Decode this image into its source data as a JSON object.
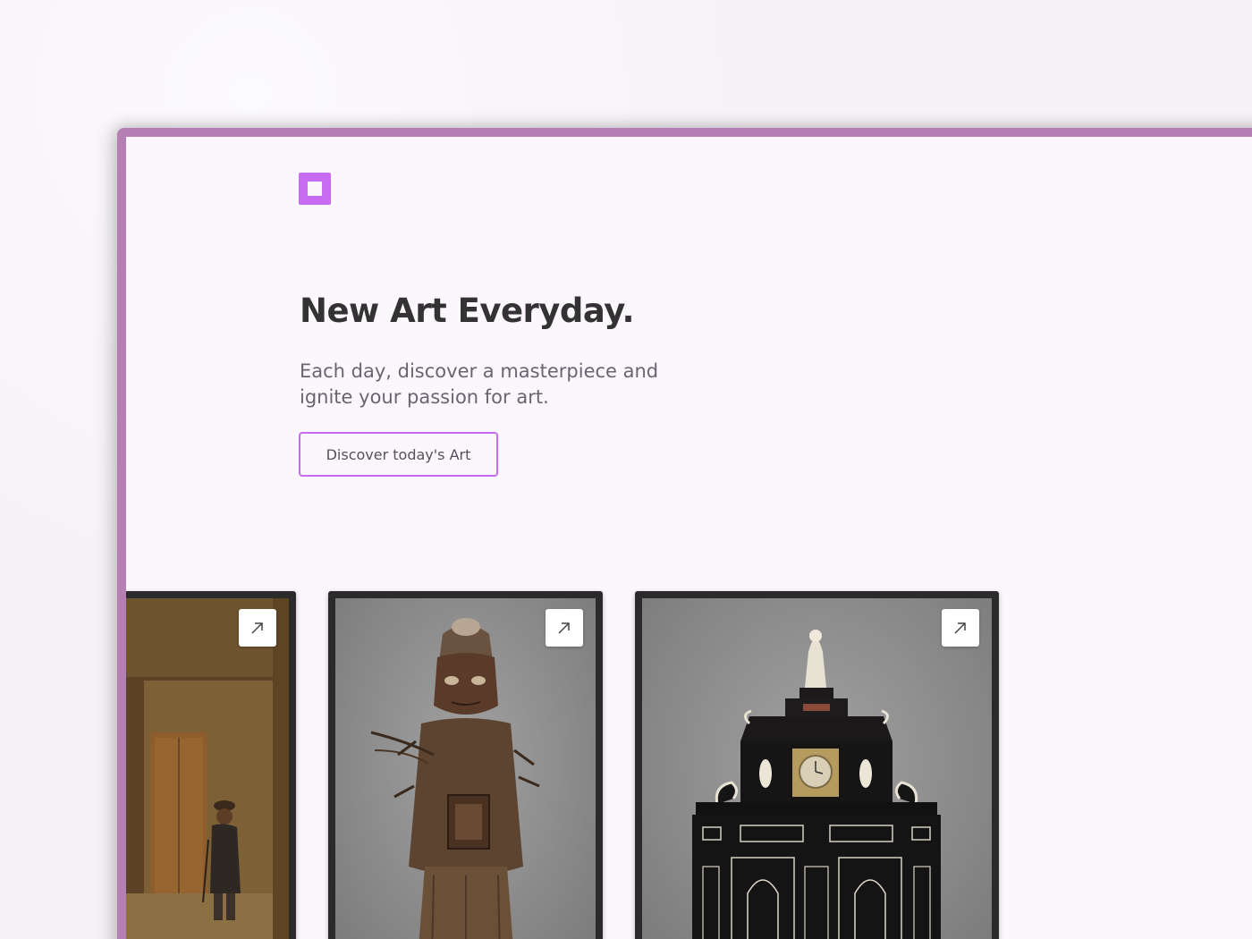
{
  "brand": {
    "logo_icon": "square-logo-icon",
    "accent_color": "#c76bf0",
    "frame_color": "#b67fb4"
  },
  "hero": {
    "title": "New Art Everyday.",
    "subtitle": "Each day, discover a masterpiece and ignite your passion for art.",
    "cta_label": "Discover today's Art"
  },
  "gallery": {
    "cards": [
      {
        "subject": "painting-interior-with-figure",
        "action_icon": "arrow-up-right-icon"
      },
      {
        "subject": "carved-wooden-figure",
        "action_icon": "arrow-up-right-icon"
      },
      {
        "subject": "ornate-cabinet-with-clock",
        "action_icon": "arrow-up-right-icon"
      }
    ]
  }
}
